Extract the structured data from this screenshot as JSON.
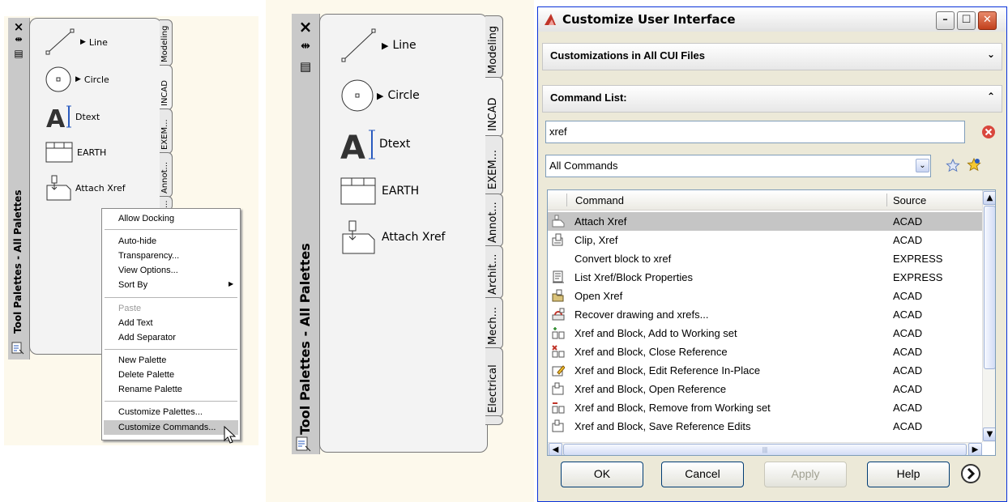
{
  "left_palette": {
    "title": "Tool Palettes - All Palettes",
    "controls": {
      "close": "×",
      "autohide": "⇹",
      "properties": "▤"
    },
    "tools": [
      {
        "label": "Line",
        "icon": "line-icon"
      },
      {
        "label": "Circle",
        "icon": "circle-icon"
      },
      {
        "label": "Dtext",
        "icon": "dtext-icon"
      },
      {
        "label": "EARTH",
        "icon": "earth-hatch-icon"
      },
      {
        "label": "Attach Xref",
        "icon": "attach-xref-icon"
      }
    ],
    "tabs": [
      "Modeling",
      "INCAD",
      "EXEM...",
      "Annot...",
      "..."
    ]
  },
  "context_menu": {
    "items": [
      {
        "label": "Allow Docking",
        "disabled": false
      },
      {
        "label": "Auto-hide",
        "disabled": false
      },
      {
        "label": "Transparency...",
        "disabled": false
      },
      {
        "label": "View Options...",
        "disabled": false
      },
      {
        "label": "Sort By",
        "disabled": false,
        "submenu": true
      },
      {
        "label": "Paste",
        "disabled": true
      },
      {
        "label": "Add Text",
        "disabled": false
      },
      {
        "label": "Add Separator",
        "disabled": false
      },
      {
        "label": "New Palette",
        "disabled": false
      },
      {
        "label": "Delete Palette",
        "disabled": false
      },
      {
        "label": "Rename Palette",
        "disabled": false
      },
      {
        "label": "Customize Palettes...",
        "disabled": false
      },
      {
        "label": "Customize Commands...",
        "disabled": false,
        "highlighted": true
      }
    ],
    "submenu_arrow": "▶"
  },
  "right_palette": {
    "title": "Tool Palettes - All Palettes",
    "controls": {
      "close": "×",
      "autohide": "⇹",
      "properties": "▤"
    },
    "tools": [
      {
        "label": "Line",
        "icon": "line-icon"
      },
      {
        "label": "Circle",
        "icon": "circle-icon"
      },
      {
        "label": "Dtext",
        "icon": "dtext-icon"
      },
      {
        "label": "EARTH",
        "icon": "earth-hatch-icon"
      },
      {
        "label": "Attach Xref",
        "icon": "attach-xref-icon"
      }
    ],
    "tabs": [
      "Modeling",
      "INCAD",
      "EXEM...",
      "Annot...",
      "Archit...",
      "Mech...",
      "Electrical"
    ]
  },
  "dialog": {
    "title": "Customize User Interface",
    "section1": "Customizations in All CUI Files",
    "section2": "Command List:",
    "search_value": "xref",
    "filter_value": "All Commands",
    "columns": {
      "command": "Command",
      "source": "Source"
    },
    "rows": [
      {
        "command": "Attach Xref",
        "source": "ACAD",
        "selected": true
      },
      {
        "command": "Clip, Xref",
        "source": "ACAD"
      },
      {
        "command": "Convert block to xref",
        "source": "EXPRESS"
      },
      {
        "command": "List Xref/Block Properties",
        "source": "EXPRESS"
      },
      {
        "command": "Open Xref",
        "source": "ACAD"
      },
      {
        "command": "Recover drawing and xrefs...",
        "source": "ACAD"
      },
      {
        "command": "Xref and Block, Add to Working set",
        "source": "ACAD"
      },
      {
        "command": "Xref and Block, Close Reference",
        "source": "ACAD"
      },
      {
        "command": "Xref and Block, Edit Reference In-Place",
        "source": "ACAD"
      },
      {
        "command": "Xref and Block, Open Reference",
        "source": "ACAD"
      },
      {
        "command": "Xref and Block, Remove from Working set",
        "source": "ACAD"
      },
      {
        "command": "Xref and Block, Save Reference Edits",
        "source": "ACAD"
      }
    ],
    "buttons": {
      "ok": "OK",
      "cancel": "Cancel",
      "apply": "Apply",
      "help": "Help"
    },
    "scroll_grip": "|||",
    "accent": "#0831d9"
  }
}
